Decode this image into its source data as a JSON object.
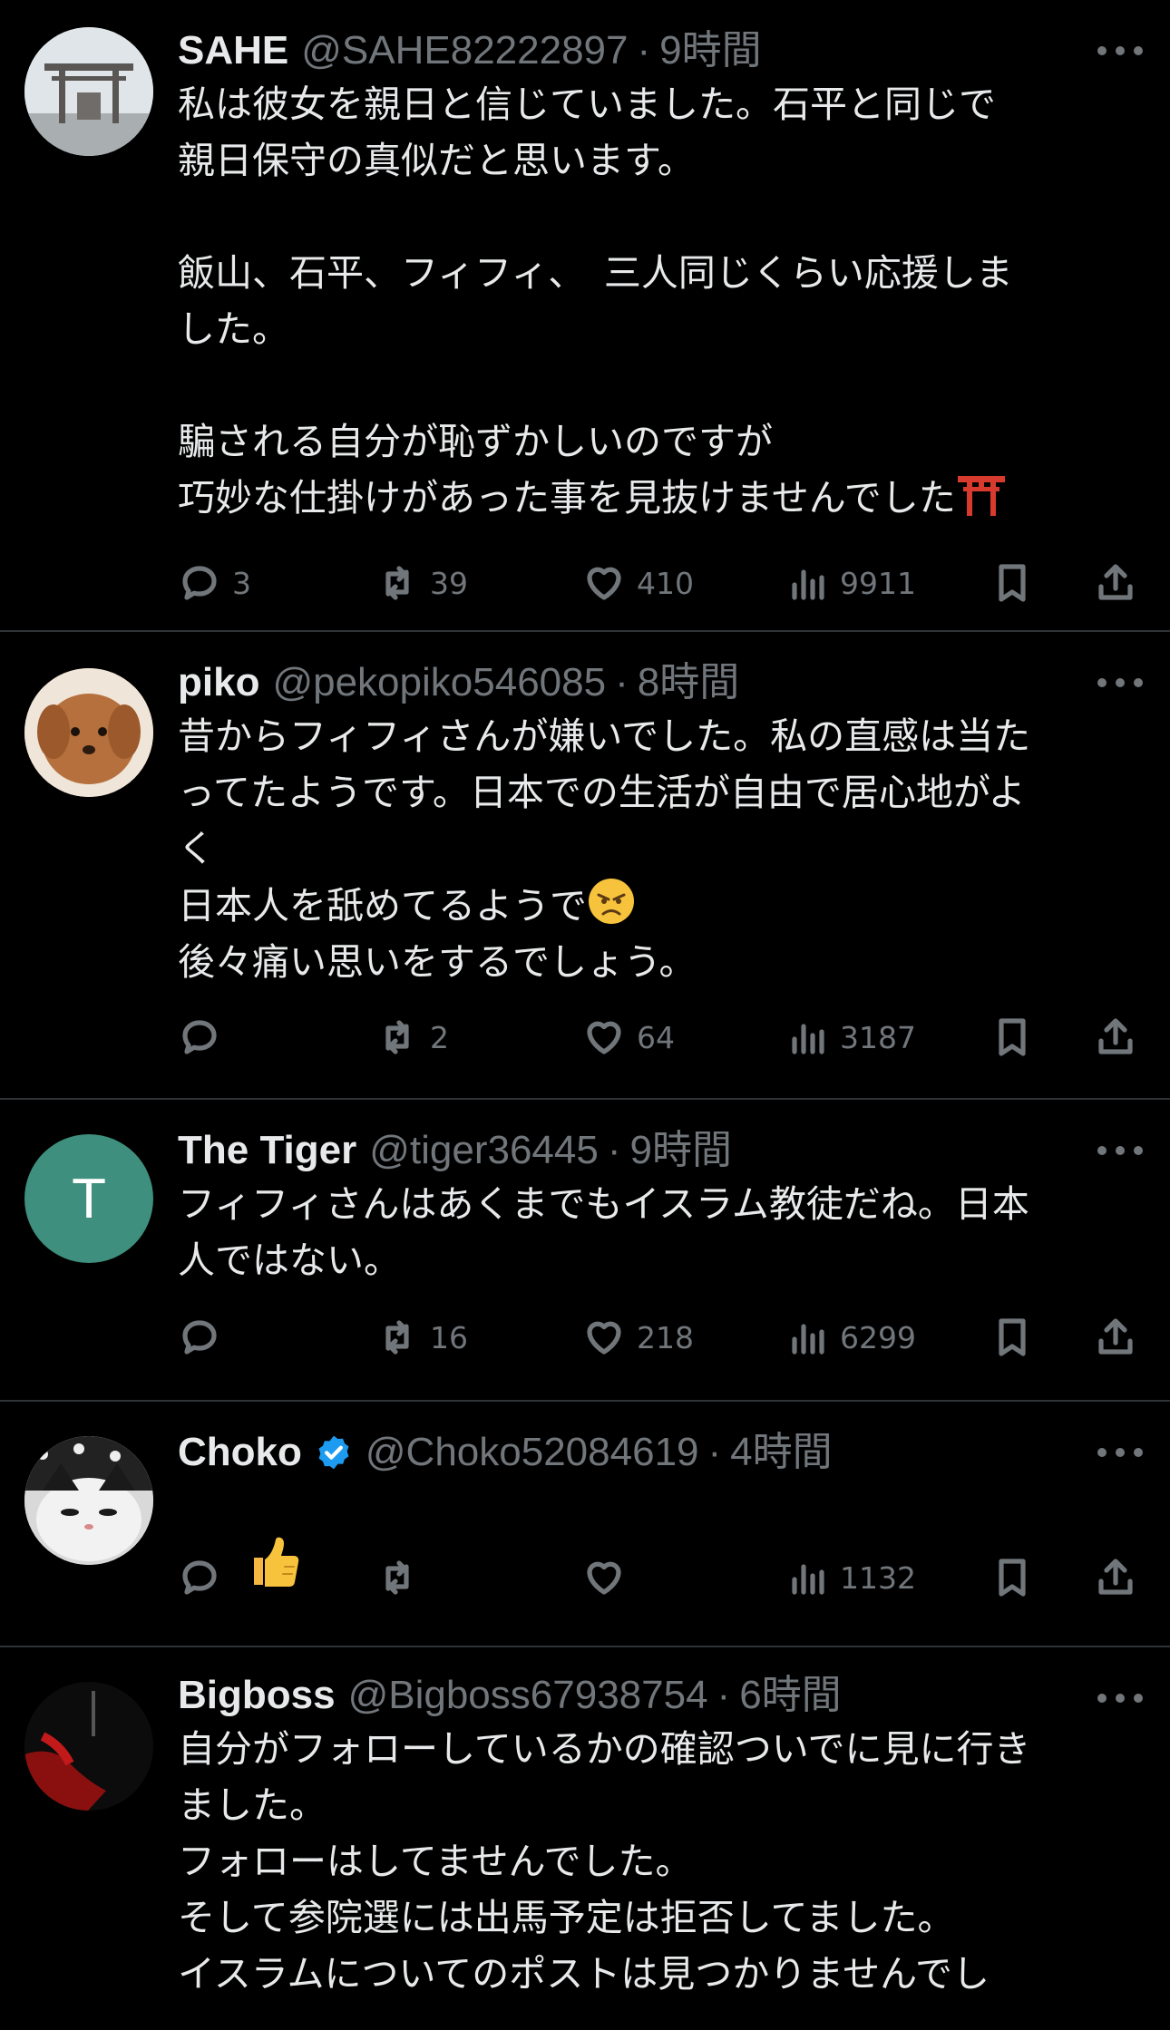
{
  "tweets": [
    {
      "name": "SAHE",
      "handle": "@SAHE82222897",
      "time": "9時間",
      "text": "私は彼女を親日と信じていました。石平と同じで\n親日保守の真似だと思います。\n\n飯山、石平、フィフィ、　三人同じくらい応援しま\nした。\n\n騙される自分が恥ずかしいのですが\n巧妙な仕掛けがあった事を見抜けませんでした",
      "emoji": "shinto-shrine-emoji",
      "replies": "3",
      "reposts": "39",
      "likes": "410",
      "views": "9911"
    },
    {
      "name": "piko",
      "handle": "@pekopiko546085",
      "time": "8時間",
      "text": "昔からフィフィさんが嫌いでした。私の直感は当た\nってたようです。日本での生活が自由で居心地がよ\nく\n日本人を舐めてるようで",
      "emoji": "angry-face-emoji",
      "text2": "\n後々痛い思いをするでしょう。",
      "replies": "",
      "reposts": "2",
      "likes": "64",
      "views": "3187"
    },
    {
      "name": "The Tiger",
      "handle": "@tiger36445",
      "time": "9時間",
      "avatar_letter": "T",
      "text": "フィフィさんはあくまでもイスラム教徒だね。日本\n人ではない。",
      "replies": "",
      "reposts": "16",
      "likes": "218",
      "views": "6299"
    },
    {
      "name": "Choko",
      "handle": "@Choko52084619",
      "time": "4時間",
      "verified": true,
      "text": "",
      "emoji": "thumbs-up-emoji",
      "replies": "",
      "reposts": "",
      "likes": "",
      "views": "1132"
    },
    {
      "name": "Bigboss",
      "handle": "@Bigboss67938754",
      "time": "6時間",
      "text": "自分がフォローしているかの確認ついでに見に行き\nました。\nフォローはしてませんでした。\nそして参院選には出馬予定は拒否してました。\nイスラムについてのポストは見つかりませんでし"
    }
  ],
  "colors": {
    "background": "#000000",
    "text": "#e7e9ea",
    "secondary": "#71767b",
    "divider": "#2f3336",
    "verified": "#1d9bf0",
    "tiger_avatar": "#3e8f7d"
  }
}
